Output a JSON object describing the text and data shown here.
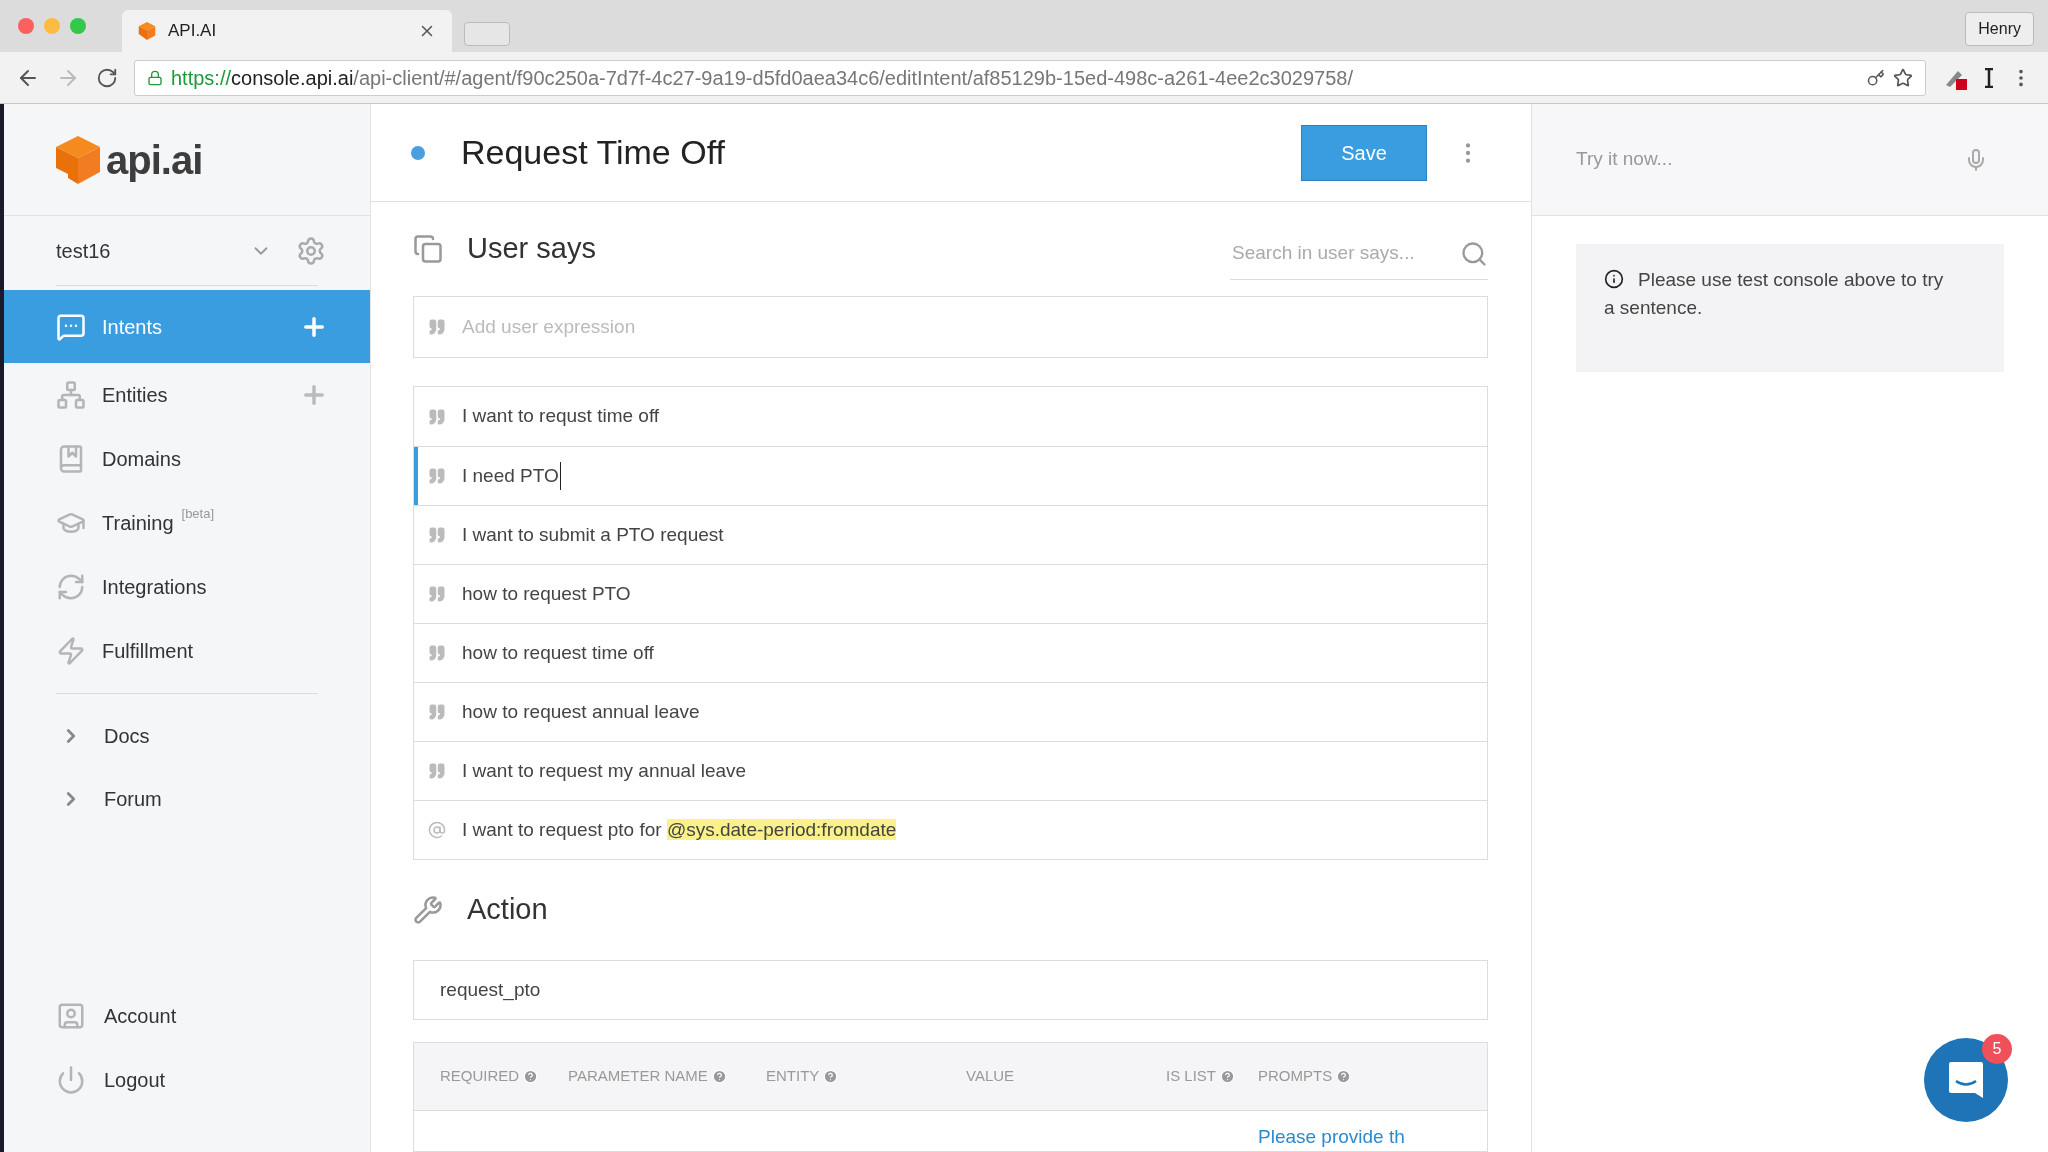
{
  "browser": {
    "tab_title": "API.AI",
    "profile": "Henry",
    "url": {
      "scheme": "https://",
      "host": "console.api.ai",
      "path": "/api-client/#/agent/f90c250a-7d7f-4c27-9a19-d5fd0aea34c6/editIntent/af85129b-15ed-498c-a261-4ee2c3029758/"
    }
  },
  "sidebar": {
    "logo": "api.ai",
    "agent": "test16",
    "items": [
      {
        "label": "Intents",
        "kind": "nav",
        "selected": true,
        "add": true
      },
      {
        "label": "Entities",
        "kind": "nav",
        "selected": false,
        "add": true
      },
      {
        "label": "Domains",
        "kind": "nav",
        "selected": false,
        "add": false
      },
      {
        "label": "Training",
        "kind": "nav",
        "selected": false,
        "add": false,
        "tag": "[beta]"
      },
      {
        "label": "Integrations",
        "kind": "nav",
        "selected": false,
        "add": false
      },
      {
        "label": "Fulfillment",
        "kind": "nav",
        "selected": false,
        "add": false
      },
      {
        "label": "Docs",
        "kind": "link",
        "selected": false,
        "add": false
      },
      {
        "label": "Forum",
        "kind": "link",
        "selected": false,
        "add": false
      }
    ],
    "bottom": [
      {
        "label": "Account"
      },
      {
        "label": "Logout"
      }
    ]
  },
  "intent": {
    "title": "Request Time Off",
    "save": "Save"
  },
  "user_says": {
    "heading": "User says",
    "search": {
      "placeholder": "Search in user says..."
    },
    "add": {
      "placeholder": "Add user expression"
    },
    "rows": [
      {
        "kind": "example",
        "text": "I want to requst time off",
        "selected": false
      },
      {
        "kind": "example",
        "text": "I need PTO",
        "selected": true
      },
      {
        "kind": "example",
        "text": "I want to submit a PTO request",
        "selected": false
      },
      {
        "kind": "example",
        "text": "how to request PTO",
        "selected": false
      },
      {
        "kind": "example",
        "text": "how to request time off",
        "selected": false
      },
      {
        "kind": "example",
        "text": "how to request annual leave",
        "selected": false
      },
      {
        "kind": "example",
        "text": "I want to request my annual leave",
        "selected": false
      },
      {
        "kind": "template",
        "text": "I want to request pto for",
        "entity": "@sys.date-period:fromdate",
        "selected": false
      }
    ]
  },
  "action": {
    "heading": "Action",
    "value": "request_pto",
    "columns": [
      {
        "label": "REQUIRED",
        "help": true
      },
      {
        "label": "PARAMETER NAME",
        "help": true
      },
      {
        "label": "ENTITY",
        "help": true
      },
      {
        "label": "VALUE",
        "help": false
      },
      {
        "label": "IS LIST",
        "help": true
      },
      {
        "label": "PROMPTS",
        "help": true
      }
    ],
    "row_prompt": "Please provide th"
  },
  "console": {
    "placeholder": "Try it now...",
    "info": "Please use test console above to try a sentence."
  },
  "chat": {
    "badge": "5"
  }
}
